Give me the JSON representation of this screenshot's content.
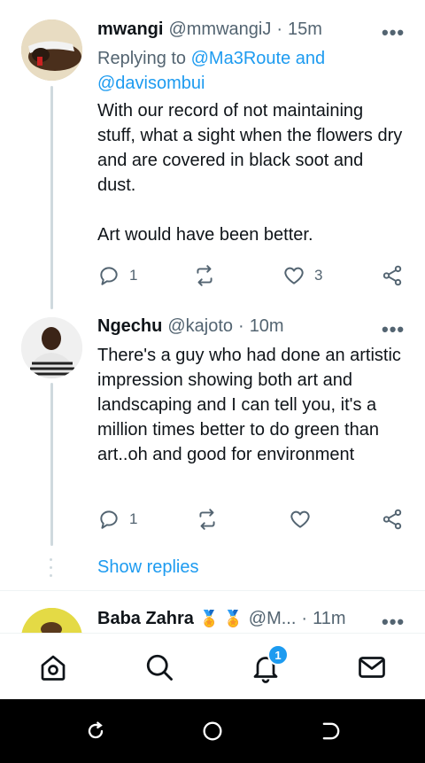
{
  "tweets": [
    {
      "name": "mwangi",
      "handle": "@mmwangiJ",
      "sep": "·",
      "time": "15m",
      "reply_prefix": "Replying to",
      "reply_to": "@Ma3Route and @davisombui",
      "text_1": "With our record of not maintaining stuff, what a sight when the flowers dry and are covered in black soot and dust.",
      "text_2": "Art would have been better.",
      "replies": "1",
      "retweets": "",
      "likes": "3"
    },
    {
      "name": "Ngechu",
      "handle": "@kajoto",
      "sep": "·",
      "time": "10m",
      "text_1": "There's a guy who had done an artistic impression showing both art and landscaping and I can tell you, it's a million times better to do green than art..oh and good for environment",
      "replies": "1",
      "retweets": "",
      "likes": ""
    },
    {
      "name": "Baba Zahra",
      "emoji": "🏅 🏅",
      "handle": "@M...",
      "sep": "·",
      "time": "11m"
    }
  ],
  "show_replies": "Show replies",
  "more_label": "•••",
  "tabbar": {
    "notifications_badge": "1",
    "accent": "#1d9bf0"
  }
}
